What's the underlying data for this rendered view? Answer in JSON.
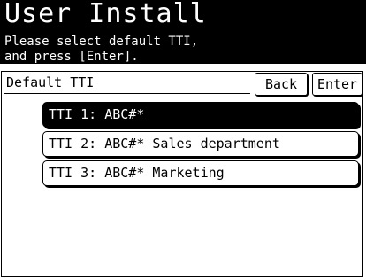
{
  "header": {
    "title": "User Install",
    "instruction_line1": "Please select default TTI,",
    "instruction_line2": "and press [Enter]."
  },
  "panel": {
    "field_label": "Default TTI",
    "back_label": "Back",
    "enter_label": "Enter"
  },
  "tti_list": [
    {
      "label": "TTI 1: ABC#*",
      "selected": true
    },
    {
      "label": "TTI 2: ABC#* Sales department",
      "selected": false
    },
    {
      "label": "TTI 3: ABC#* Marketing",
      "selected": false
    }
  ]
}
